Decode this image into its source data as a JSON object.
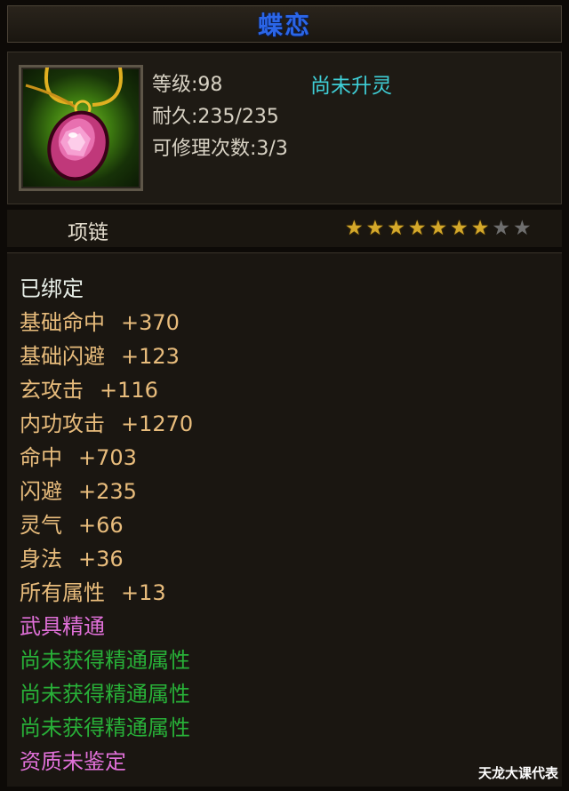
{
  "item": {
    "name": "蝶恋",
    "type": "项链",
    "level_text": "等级:98",
    "upgrade_status": "尚未升灵",
    "durability_text": "耐久:235/235",
    "repair_text": "可修理次数:3/3",
    "stars_total": 9,
    "stars_filled": 7
  },
  "attributes": {
    "bound": "已绑定",
    "stats": [
      {
        "name": "基础命中",
        "value": "+370"
      },
      {
        "name": "基础闪避",
        "value": "+123"
      },
      {
        "name": "玄攻击",
        "value": "+116"
      },
      {
        "name": "内功攻击",
        "value": "+1270"
      },
      {
        "name": "命中",
        "value": "+703"
      },
      {
        "name": "闪避",
        "value": "+235"
      },
      {
        "name": "灵气",
        "value": "+66"
      },
      {
        "name": "身法",
        "value": "+36"
      },
      {
        "name": "所有属性",
        "value": "+13"
      }
    ],
    "mastery_title": "武具精通",
    "mastery_lines": [
      "尚未获得精通属性",
      "尚未获得精通属性",
      "尚未获得精通属性"
    ],
    "quality": "资质未鉴定"
  },
  "watermark": "天龙大课代表",
  "colors": {
    "title": "#2b66e8",
    "upgrade": "#3fd0d8",
    "stat": "#e8bc7c",
    "bound": "#e8efe8",
    "mastery": "#e070d8",
    "mastery_empty": "#28b038",
    "star_on": "#d4a82a",
    "star_off": "#6e6e6e"
  },
  "icons": {
    "item_icon": "gem-necklace-icon",
    "star_icon": "star-icon"
  }
}
